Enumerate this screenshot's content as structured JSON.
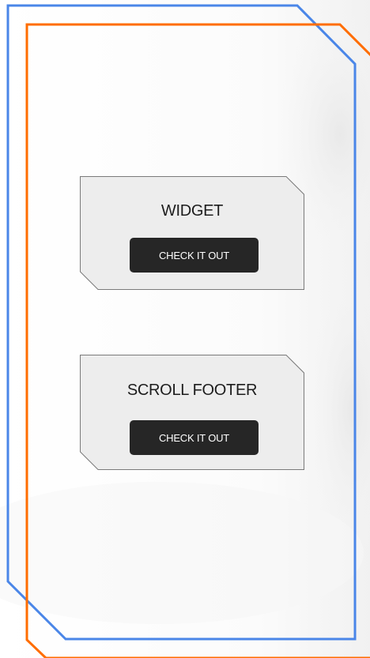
{
  "colors": {
    "frame_outer": "#4a86e8",
    "frame_inner": "#ff6d00",
    "card_fill": "#ededed",
    "card_border": "#7a7a7a",
    "button_fill": "#262626",
    "button_text": "#ffffff"
  },
  "cards": [
    {
      "title": "WIDGET",
      "button_label": "CHECK IT OUT"
    },
    {
      "title": "SCROLL FOOTER",
      "button_label": "CHECK IT OUT"
    }
  ]
}
